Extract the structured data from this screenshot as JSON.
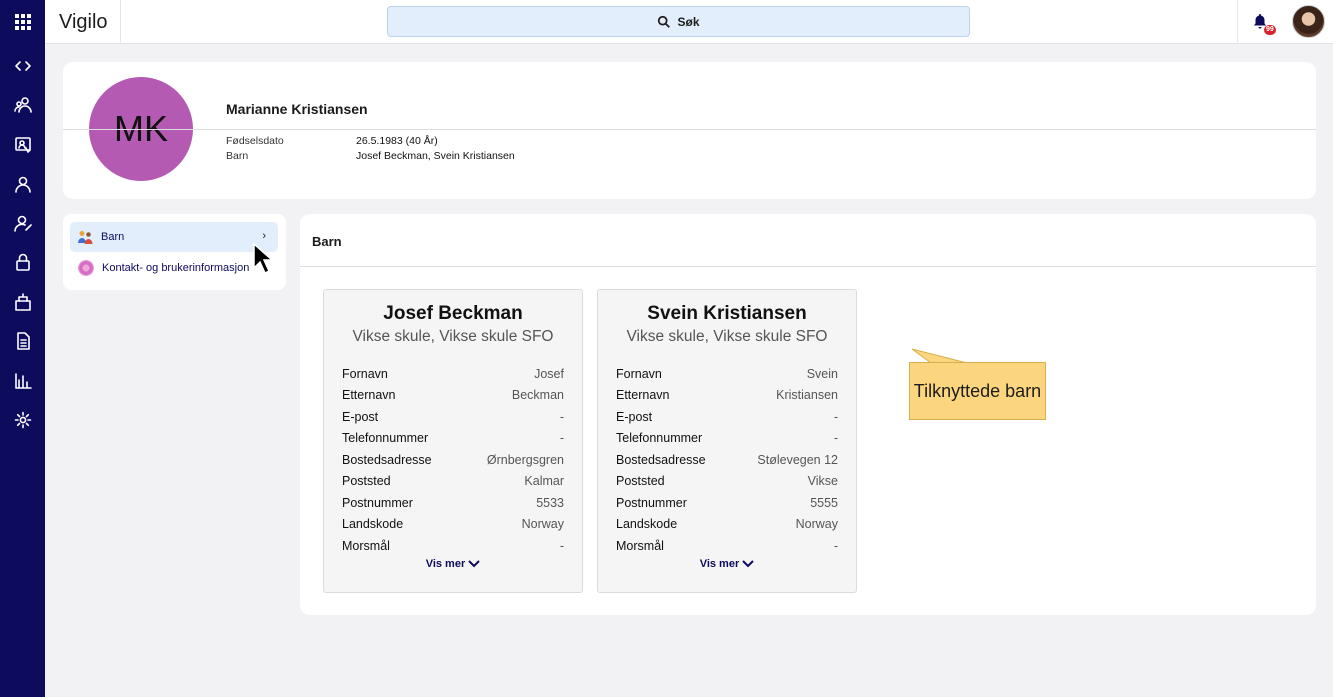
{
  "app": {
    "title": "Vigilo"
  },
  "search": {
    "label": "Søk"
  },
  "notifications": {
    "count": "99"
  },
  "rail_icons": [
    "apps-grid-icon",
    "code-icon",
    "people-icon",
    "attendance-icon",
    "person-icon",
    "person-edit-icon",
    "lock-icon",
    "kindergarten-icon",
    "document-icon",
    "chart-icon",
    "gear-icon"
  ],
  "profile": {
    "initials": "MK",
    "avatar_color": "#b45ab2",
    "name": "Marianne Kristiansen",
    "fields": [
      {
        "label": "Fødselsdato",
        "value": "26.5.1983 (40 År)"
      },
      {
        "label": "Barn",
        "value": "Josef Beckman, Svein Kristiansen"
      }
    ]
  },
  "menu": {
    "items": [
      {
        "label": "Barn",
        "active": true
      },
      {
        "label": "Kontakt- og brukerinformasjon",
        "active": false
      }
    ]
  },
  "panel": {
    "title": "Barn"
  },
  "children": [
    {
      "name": "Josef Beckman",
      "school": "Vikse skule, Vikse skule SFO",
      "fields": [
        {
          "label": "Fornavn",
          "value": "Josef"
        },
        {
          "label": "Etternavn",
          "value": "Beckman"
        },
        {
          "label": "E-post",
          "value": "-"
        },
        {
          "label": "Telefonnummer",
          "value": "-"
        },
        {
          "label": "Bostedsadresse",
          "value": "Ørnbergsgren"
        },
        {
          "label": "Poststed",
          "value": "Kalmar"
        },
        {
          "label": "Postnummer",
          "value": "5533"
        },
        {
          "label": "Landskode",
          "value": "Norway"
        },
        {
          "label": "Morsmål",
          "value": "-"
        }
      ],
      "more_label": "Vis mer"
    },
    {
      "name": "Svein Kristiansen",
      "school": "Vikse skule, Vikse skule SFO",
      "fields": [
        {
          "label": "Fornavn",
          "value": "Svein"
        },
        {
          "label": "Etternavn",
          "value": "Kristiansen"
        },
        {
          "label": "E-post",
          "value": "-"
        },
        {
          "label": "Telefonnummer",
          "value": "-"
        },
        {
          "label": "Bostedsadresse",
          "value": "Stølevegen 12"
        },
        {
          "label": "Poststed",
          "value": "Vikse"
        },
        {
          "label": "Postnummer",
          "value": "5555"
        },
        {
          "label": "Landskode",
          "value": "Norway"
        },
        {
          "label": "Morsmål",
          "value": "-"
        }
      ],
      "more_label": "Vis mer"
    }
  ],
  "callout": {
    "text": "Tilknyttede barn"
  }
}
